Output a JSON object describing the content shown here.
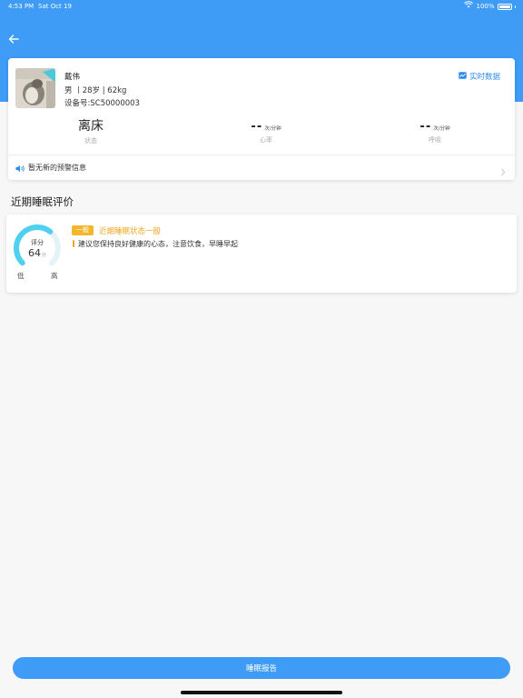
{
  "status_bar": {
    "time": "4:53 PM",
    "date": "Sat Oct 19",
    "battery": "100%"
  },
  "colors": {
    "primary": "#3e9bf6",
    "accent_orange": "#f5a623",
    "badge_yellow": "#f5b62b",
    "gauge_cyan": "#4fd0f0"
  },
  "icons": {
    "back": "arrow-left-icon",
    "realtime": "chart-icon",
    "warning": "speaker-icon",
    "chevron": "chevron-right-icon",
    "wifi": "wifi-icon",
    "battery": "battery-icon"
  },
  "profile": {
    "name": "戴伟",
    "meta": "男 丨28岁 | 62kg",
    "device": "设备号:SC50000003",
    "realtime_label": "实时数据"
  },
  "stats": {
    "state": {
      "value": "离床",
      "label": "状态"
    },
    "heart_rate": {
      "value": "--",
      "unit": "次/分钟",
      "label": "心率"
    },
    "breathing": {
      "value": "--",
      "unit": "次/分钟",
      "label": "呼吸"
    }
  },
  "warning": {
    "text": "暂无新的预警信息"
  },
  "sleep": {
    "section_title": "近期睡眠评价",
    "score_label": "评分",
    "score": "64",
    "score_unit": "分",
    "score_fraction": 0.64,
    "low_label": "低",
    "high_label": "高",
    "badge": "一般",
    "title": "近期睡眠状态一般",
    "advice": "建议您保持良好健康的心态，注意饮食，早睡早起"
  },
  "report_button": {
    "label": "睡眠报告"
  }
}
